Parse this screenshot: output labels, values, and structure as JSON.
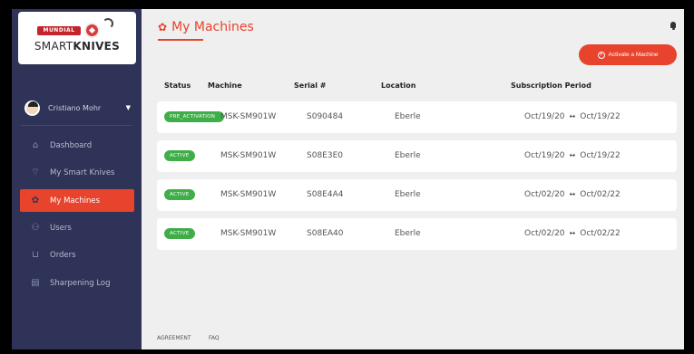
{
  "brand": {
    "top": "MUNDIAL",
    "light": "SMART",
    "bold": "KNIVES"
  },
  "user": {
    "name": "Cristiano Mohr"
  },
  "nav": [
    {
      "label": "Dashboard",
      "icon": "dashboard-icon"
    },
    {
      "label": "My Smart Knives",
      "icon": "knife-icon"
    },
    {
      "label": "My Machines",
      "icon": "gear-icon",
      "active": true
    },
    {
      "label": "Users",
      "icon": "users-icon"
    },
    {
      "label": "Orders",
      "icon": "cart-icon"
    },
    {
      "label": "Sharpening Log",
      "icon": "log-icon"
    }
  ],
  "page": {
    "title": "My Machines"
  },
  "activate_button": "Activate a Machine",
  "table": {
    "headers": {
      "status": "Status",
      "machine": "Machine",
      "serial": "Serial #",
      "location": "Location",
      "period": "Subscription Period"
    },
    "rows": [
      {
        "status": "PRE_ACTIVATION",
        "machine": "MSK-SM901W",
        "serial": "S090484",
        "location": "Eberle",
        "start": "Oct/19/20",
        "end": "Oct/19/22"
      },
      {
        "status": "ACTIVE",
        "machine": "MSK-SM901W",
        "serial": "S08E3E0",
        "location": "Eberle",
        "start": "Oct/19/20",
        "end": "Oct/19/22"
      },
      {
        "status": "ACTIVE",
        "machine": "MSK-SM901W",
        "serial": "S08E4A4",
        "location": "Eberle",
        "start": "Oct/02/20",
        "end": "Oct/02/22"
      },
      {
        "status": "ACTIVE",
        "machine": "MSK-SM901W",
        "serial": "S08EA40",
        "location": "Eberle",
        "start": "Oct/02/20",
        "end": "Oct/02/22"
      }
    ]
  },
  "footer": {
    "agreement": "AGREEMENT",
    "faq": "FAQ"
  },
  "colors": {
    "accent": "#e8432c",
    "sidebar": "#2e3357",
    "active_badge": "#3fae49"
  }
}
